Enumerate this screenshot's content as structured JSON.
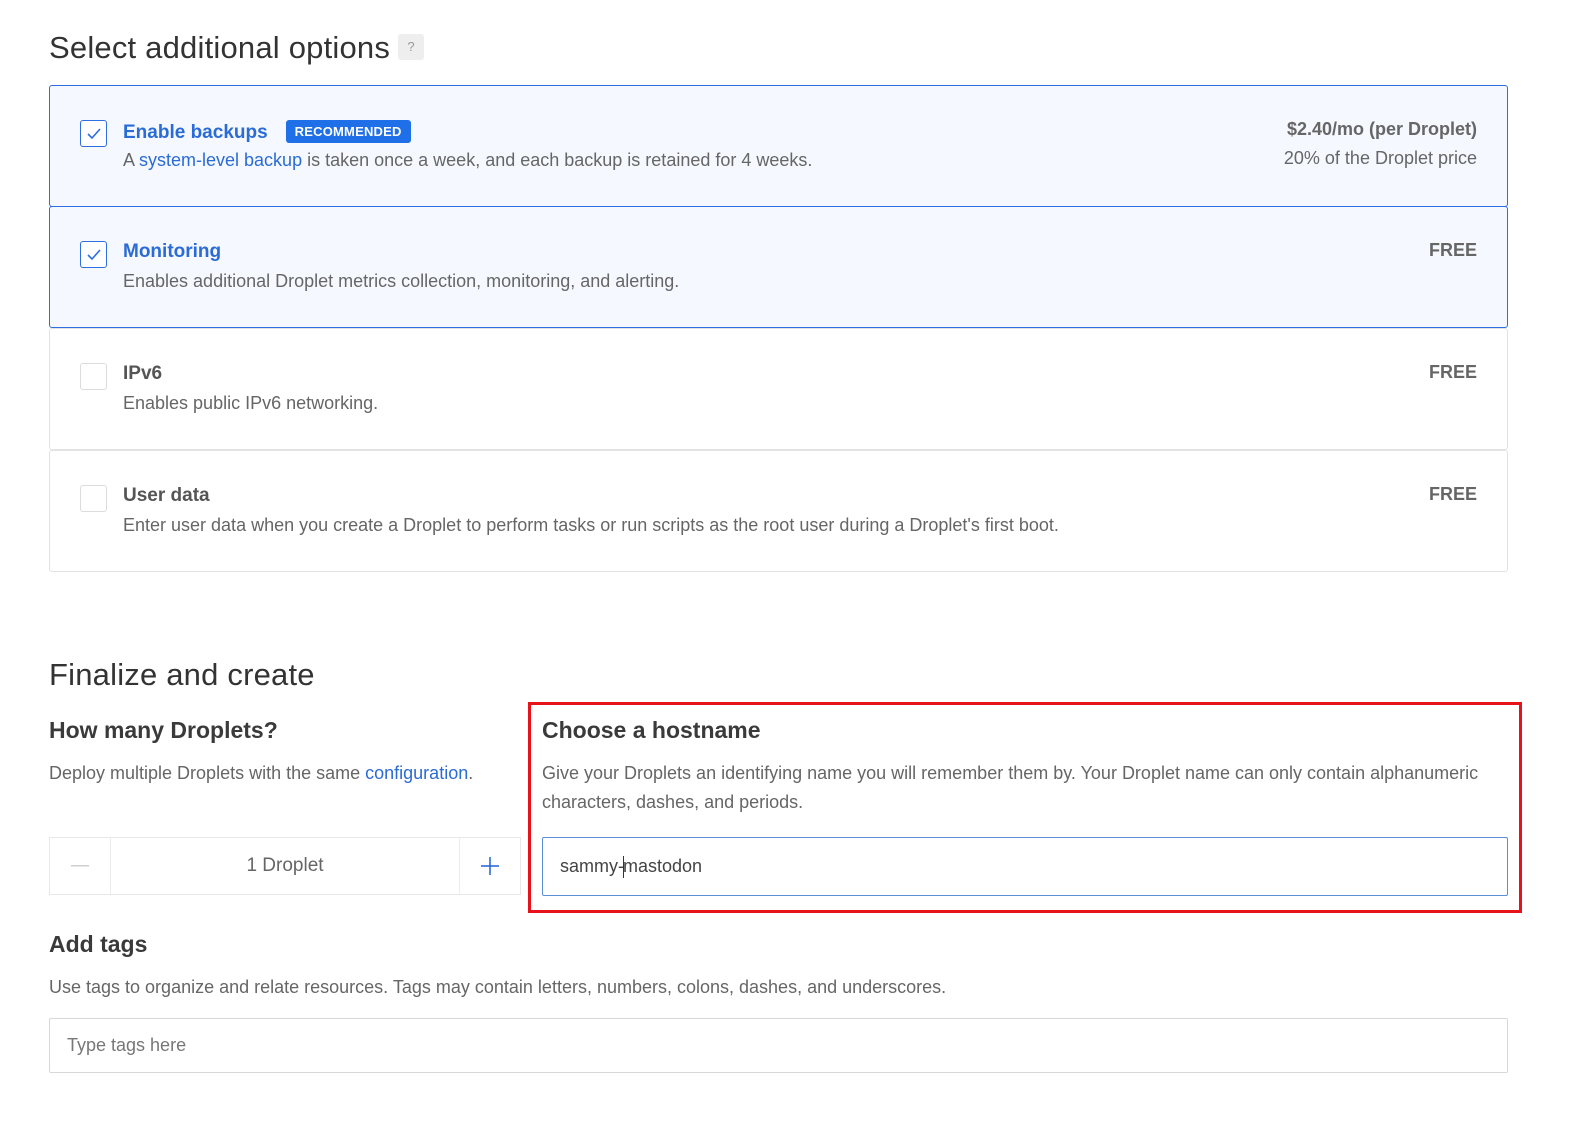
{
  "additional_options": {
    "title": "Select additional options",
    "help_label": "?",
    "items": [
      {
        "title": "Enable backups",
        "badge": "RECOMMENDED",
        "checked": true,
        "description_prefix": "A ",
        "description_link": "system-level backup",
        "description_suffix": " is taken once a week, and each backup is retained for 4 weeks.",
        "price": "$2.40/mo (per Droplet)",
        "price_note": "20% of the Droplet price"
      },
      {
        "title": "Monitoring",
        "checked": true,
        "description": "Enables additional Droplet metrics collection, monitoring, and alerting.",
        "price": "FREE"
      },
      {
        "title": "IPv6",
        "checked": false,
        "description": "Enables public IPv6 networking.",
        "price": "FREE"
      },
      {
        "title": "User data",
        "checked": false,
        "description": "Enter user data when you create a Droplet to perform tasks or run scripts as the root user during a Droplet's first boot.",
        "price": "FREE"
      }
    ]
  },
  "finalize": {
    "title": "Finalize and create",
    "droplets": {
      "heading": "How many Droplets?",
      "description_prefix": "Deploy multiple Droplets with the same ",
      "description_link": "configuration",
      "description_suffix": ".",
      "count": "1",
      "unit": "Droplet",
      "minus_icon": "minus-icon",
      "plus_icon": "plus-icon"
    },
    "hostname": {
      "heading": "Choose a hostname",
      "description": "Give your Droplets an identifying name you will remember them by. Your Droplet name can only contain alphanumeric characters, dashes, and periods.",
      "value_before_caret": "sammy-",
      "value_after_caret": "mastodon"
    },
    "tags": {
      "heading": "Add tags",
      "description": "Use tags to organize and relate resources. Tags may contain letters, numbers, colons, dashes, and underscores.",
      "placeholder": "Type tags here"
    }
  },
  "colors": {
    "accent": "#2b6bd6",
    "badge": "#1f6fe8",
    "selected_bg": "#f5f8ff",
    "highlight": "#e8121a"
  }
}
